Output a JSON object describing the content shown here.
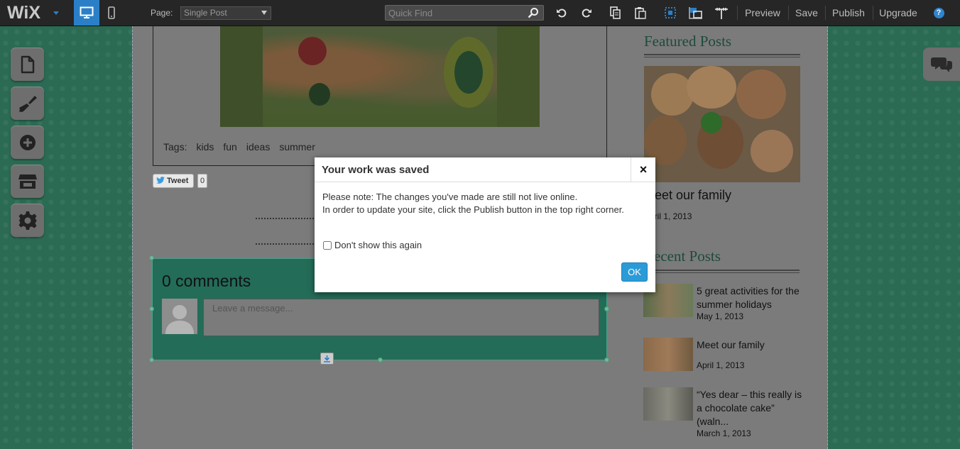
{
  "toolbar": {
    "logo": "WiX",
    "page_label": "Page:",
    "page_selected": "Single Post",
    "quick_find_placeholder": "Quick Find",
    "preview": "Preview",
    "save": "Save",
    "publish": "Publish",
    "upgrade": "Upgrade",
    "help": "?"
  },
  "sidebar": {
    "items": [
      {
        "name": "pages",
        "icon": "page-icon"
      },
      {
        "name": "design",
        "icon": "brush-icon"
      },
      {
        "name": "add",
        "icon": "plus-circle-icon"
      },
      {
        "name": "app-market",
        "icon": "store-icon"
      },
      {
        "name": "settings",
        "icon": "gear-icon"
      }
    ]
  },
  "post": {
    "tags_label": "Tags:",
    "tags": [
      "kids",
      "fun",
      "ideas",
      "summer"
    ],
    "tweet_label": "Tweet",
    "tweet_count": "0"
  },
  "comments": {
    "title": "0 comments",
    "placeholder": "Leave a message..."
  },
  "right_sidebar": {
    "featured_title": "Featured Posts",
    "featured_post": {
      "title": "Meet our family",
      "date": "April 1, 2013"
    },
    "recent_title": "Recent Posts",
    "recent_posts": [
      {
        "title": "5 great activities for the summer holidays",
        "date": "May 1, 2013"
      },
      {
        "title": "Meet our family",
        "date": "April 1, 2013"
      },
      {
        "title": "“Yes dear – this really is a chocolate cake” (waln...",
        "date": "March 1, 2013"
      }
    ]
  },
  "modal": {
    "title": "Your work was saved",
    "close": "×",
    "line1": "Please note: The changes you've made are still not live online.",
    "line2": "In order to update your site, click the Publish button in the top right corner.",
    "checkbox_label": "Don't show this again",
    "ok": "OK"
  },
  "colors": {
    "toolbar_bg": "#262626",
    "accent_blue": "#2b7fc7",
    "site_green": "#2b6b53",
    "ok_blue": "#2b9bd8"
  }
}
